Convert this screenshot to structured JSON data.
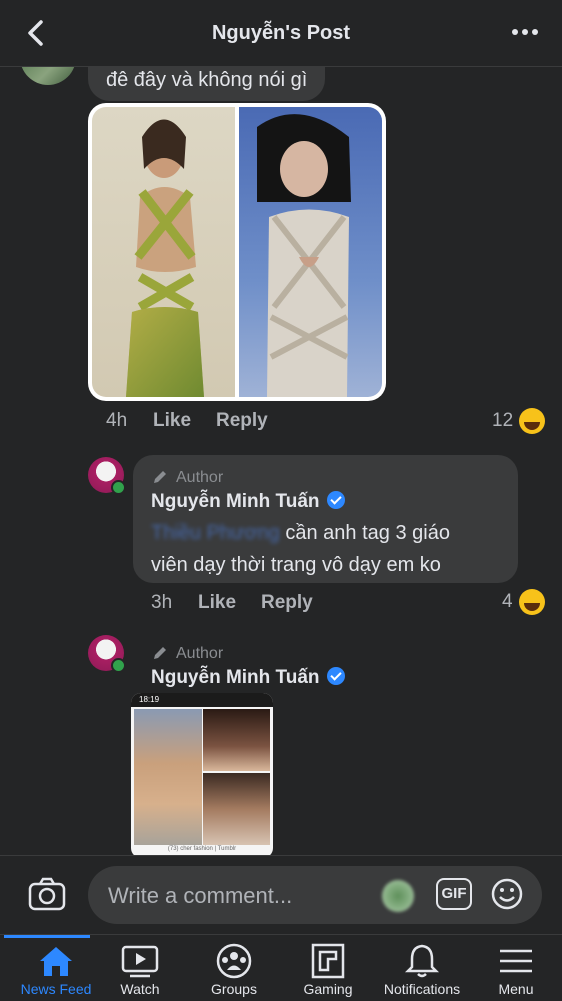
{
  "header": {
    "title": "Nguyễn's Post",
    "back_icon": "chevron-left-icon",
    "more_icon": "more-horizontal-icon"
  },
  "comment1": {
    "text": "đê đây và không nói gì",
    "time": "4h",
    "like_label": "Like",
    "reply_label": "Reply",
    "reaction_count": "12",
    "reaction_icon": "laugh-emoji-icon"
  },
  "comment2": {
    "author_badge": "Author",
    "name": "Nguyễn Minh Tuấn",
    "tag": "Thiều Phương",
    "text_line1": "cần anh tag 3 giáo",
    "text_line2": "viên dạy thời trang vô dạy em ko",
    "time": "3h",
    "like_label": "Like",
    "reply_label": "Reply",
    "reaction_count": "4",
    "reaction_icon": "laugh-emoji-icon"
  },
  "comment3": {
    "author_badge": "Author",
    "name": "Nguyễn Minh Tuấn",
    "screenshot_caption": "(73) cher fashion | Tumblr",
    "screenshot_time": "18:19"
  },
  "composer": {
    "placeholder": "Write a comment...",
    "gif_label": "GIF",
    "camera_icon": "camera-icon",
    "emoji_icon": "smiley-icon"
  },
  "tabs": [
    {
      "label": "News Feed",
      "icon": "home-icon",
      "active": true
    },
    {
      "label": "Watch",
      "icon": "video-icon",
      "active": false
    },
    {
      "label": "Groups",
      "icon": "groups-icon",
      "active": false
    },
    {
      "label": "Gaming",
      "icon": "gaming-icon",
      "active": false
    },
    {
      "label": "Notifications",
      "icon": "bell-icon",
      "active": false
    },
    {
      "label": "Menu",
      "icon": "menu-icon",
      "active": false
    }
  ],
  "colors": {
    "background": "#242526",
    "bubble": "#3a3b3c",
    "accent": "#2d88ff",
    "verified": "#2d88ff",
    "online": "#31a24c"
  }
}
